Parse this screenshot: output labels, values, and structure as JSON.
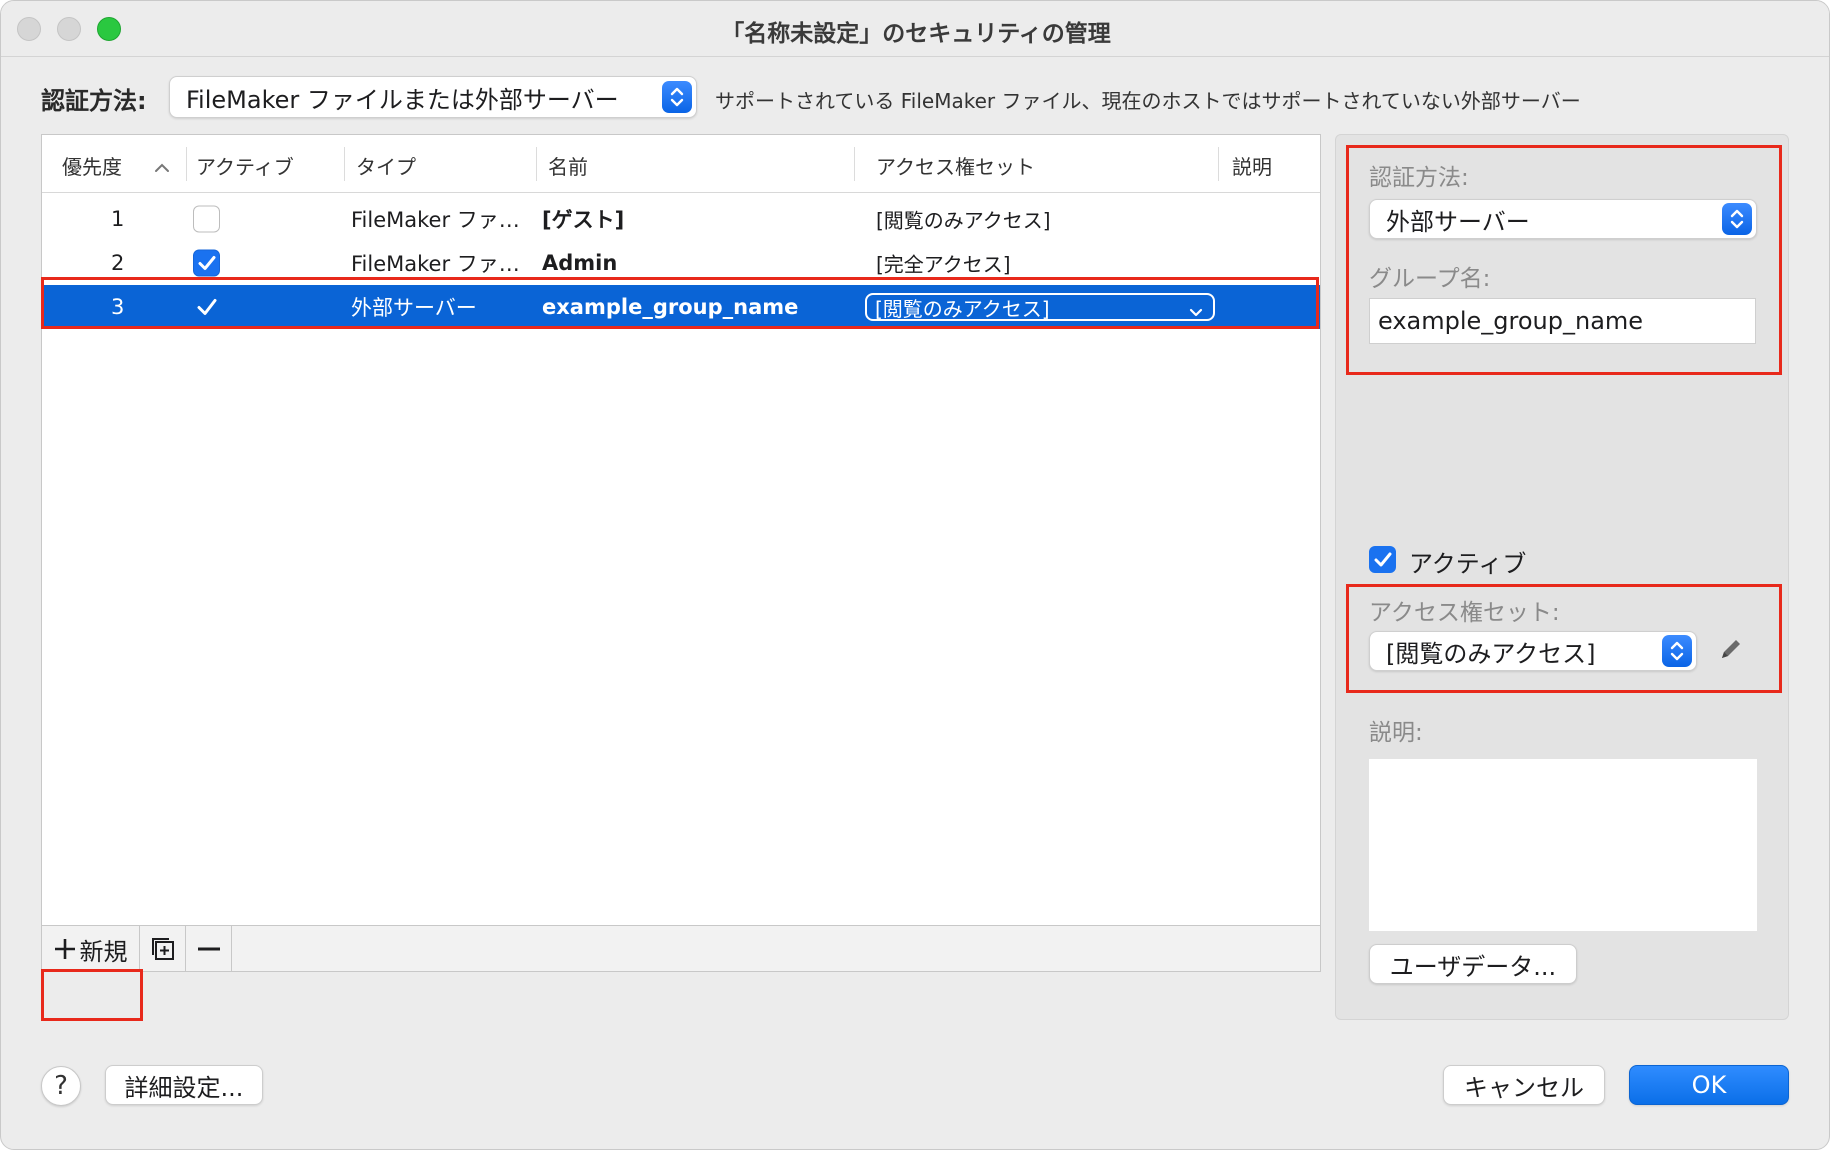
{
  "window": {
    "title": "「名称未設定」のセキュリティの管理"
  },
  "auth": {
    "label": "認証方法:",
    "selected": "FileMaker ファイルまたは外部サーバー",
    "note": "サポートされている FileMaker ファイル、現在のホストではサポートされていない外部サーバー"
  },
  "table": {
    "columns": [
      "優先度",
      "アクティブ",
      "タイプ",
      "名前",
      "アクセス権セット",
      "説明"
    ],
    "sort_indicator": "^",
    "rows": [
      {
        "priority": "1",
        "active": false,
        "type": "FileMaker ファ…",
        "name": "[ゲスト]",
        "privilege": "[閲覧のみアクセス]"
      },
      {
        "priority": "2",
        "active": true,
        "type": "FileMaker ファ…",
        "name": "Admin",
        "privilege": "[完全アクセス]"
      },
      {
        "priority": "3",
        "active": true,
        "type": "外部サーバー",
        "name": "example_group_name",
        "privilege": "[閲覧のみアクセス]"
      }
    ],
    "footer": {
      "new_label": "新規"
    }
  },
  "detail": {
    "auth_label": "認証方法:",
    "auth_value": "外部サーバー",
    "group_label": "グループ名:",
    "group_value": "example_group_name",
    "active_label": "アクティブ",
    "active_checked": true,
    "privilege_label": "アクセス権セット:",
    "privilege_value": "[閲覧のみアクセス]",
    "description_label": "説明:",
    "description_value": "",
    "user_data_button": "ユーザデータ..."
  },
  "bottom": {
    "help": "?",
    "advanced": "詳細設定...",
    "cancel": "キャンセル",
    "ok": "OK"
  },
  "colors": {
    "accent": "#0a64d6",
    "annotation": "#e8291b"
  }
}
